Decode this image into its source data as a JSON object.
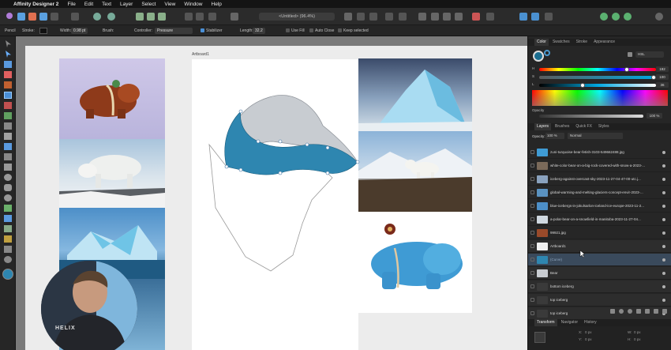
{
  "menubar": {
    "apple": "",
    "app_name": "Affinity Designer 2",
    "items": [
      "File",
      "Edit",
      "Text",
      "Layer",
      "Select",
      "View",
      "Window",
      "Help"
    ]
  },
  "document_tab": "<Untitled> (96.4%)",
  "context": {
    "tool": "Pencil",
    "stroke_label": "Stroke:",
    "width_label": "Width:",
    "width_value": "0.98 pt",
    "brush_label": "Brush:",
    "controller_label": "Controller:",
    "controller_value": "Pressure",
    "stabilizer": "Stabilizer",
    "length_label": "Length:",
    "length_value": "32.2",
    "use_fill": "Use Fill",
    "auto_close": "Auto Close",
    "keep_selected": "Keep selected"
  },
  "canvas": {
    "artboard_label": "Artboard1"
  },
  "colors": {
    "accent": "#4a8fd6",
    "bear_blue": "#2e86b0",
    "bear_grey": "#c8ccd1",
    "selection": "#3a4a5c"
  },
  "color_panel": {
    "tabs": [
      "Color",
      "Swatches",
      "Stroke",
      "Appearance"
    ],
    "mode": "HSL",
    "h_label": "H",
    "h_value": "192",
    "s_label": "S",
    "s_value": "100",
    "l_label": "L",
    "l_value": "36",
    "opacity_label": "Opacity",
    "opacity_value": "100 %"
  },
  "layers_panel": {
    "tabs": [
      "Layers",
      "Brushes",
      "Quick FX",
      "Styles"
    ],
    "opacity_label": "Opacity:",
    "opacity_value": "100 %",
    "blend_mode": "Normal",
    "layers": [
      {
        "name": "zuni-turquoise-bear-fetish-3103-549662488.jpg"
      },
      {
        "name": "white-color-bear-on-a-big-rock-covered-with-snow-a-2023-..."
      },
      {
        "name": "iceberg-against-overcast-sky-2023-11-27-04-47-00-utc.j..."
      },
      {
        "name": "global-warming-and-melting-glaciers-concept-envir-2023-..."
      },
      {
        "name": "blue-icebergs-in-jokulsarlon-iceland-ice-europe-2023-11-2..."
      },
      {
        "name": "a-polar-bear-on-a-snowfield-in-manitoba-2023-11-27-04..."
      },
      {
        "name": "99921.jpg"
      },
      {
        "name": "Artboard1"
      },
      {
        "name": "(Curve)"
      },
      {
        "name": "Bear"
      },
      {
        "name": "bottom iceberg"
      },
      {
        "name": "top iceberg"
      },
      {
        "name": "top iceberg"
      }
    ]
  },
  "bottom_panel": {
    "tabs": [
      "Transform",
      "Navigator",
      "History"
    ],
    "x_label": "X:",
    "x_value": "0 px",
    "y_label": "Y:",
    "y_value": "0 px",
    "w_label": "W:",
    "w_value": "0 px",
    "h_label": "H:",
    "h_value": "0 px"
  },
  "webcam": {
    "shirt_text": "HELIX"
  }
}
